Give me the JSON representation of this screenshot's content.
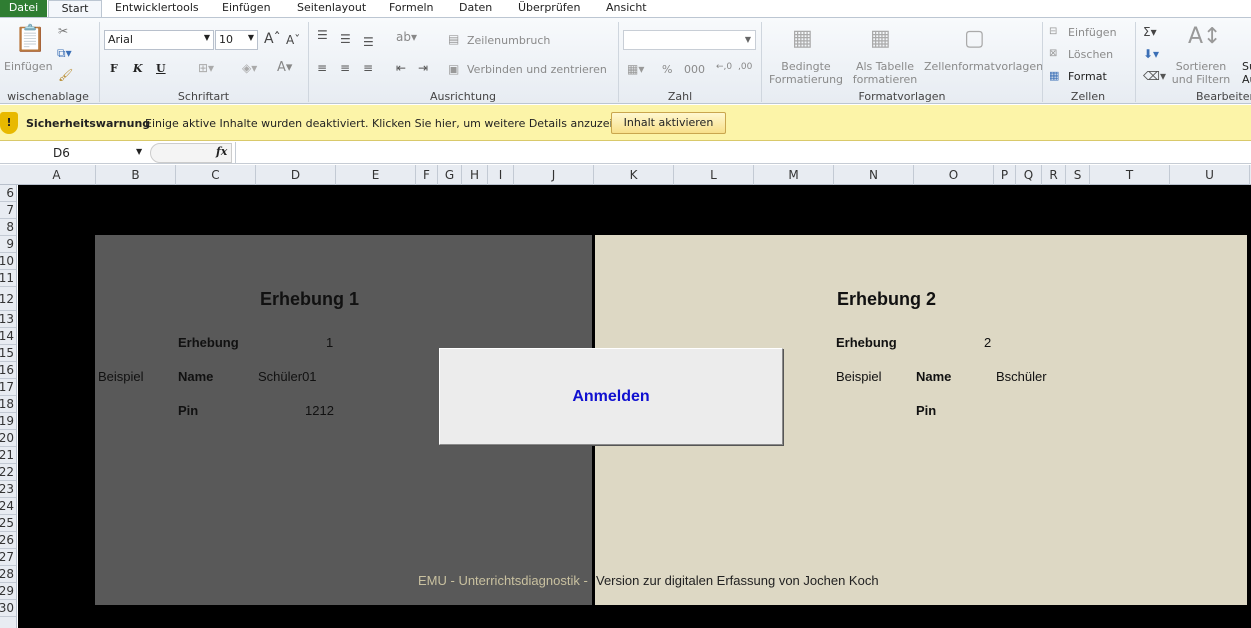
{
  "tabs": [
    "Datei",
    "Start",
    "Entwicklertools",
    "Einfügen",
    "Seitenlayout",
    "Formeln",
    "Daten",
    "Überprüfen",
    "Ansicht"
  ],
  "ribbon": {
    "clipboard": {
      "paste": "Einfügen",
      "label": "wischenablage"
    },
    "font": {
      "name": "Arial",
      "size": "10",
      "label": "Schriftart",
      "bold": "F",
      "italic": "K",
      "underline": "U"
    },
    "alignment": {
      "wrap": "Zeilenumbruch",
      "merge": "Verbinden und zentrieren",
      "label": "Ausrichtung"
    },
    "number": {
      "format": "",
      "percent": "%",
      "thousands": "000",
      "label": "Zahl"
    },
    "styles": {
      "conditional": [
        "Bedingte",
        "Formatierung"
      ],
      "table": [
        "Als Tabelle",
        "formatieren"
      ],
      "cell": "Zellenformatvorlagen",
      "label": "Formatvorlagen"
    },
    "cells": {
      "insert": "Einfügen",
      "delete": "Löschen",
      "format": "Format",
      "label": "Zellen"
    },
    "editing": {
      "sort": [
        "Sortieren",
        "und Filtern"
      ],
      "find": [
        "Su",
        "Au"
      ],
      "label": "Bearbeiten"
    }
  },
  "warning": {
    "title": "Sicherheitswarnung",
    "message": "Einige aktive Inhalte wurden deaktiviert. Klicken Sie hier, um weitere Details anzuzeigen.",
    "button": "Inhalt aktivieren"
  },
  "formula_bar": {
    "name_box": "D6",
    "fx": "fx",
    "value": ""
  },
  "columns": [
    "A",
    "B",
    "C",
    "D",
    "E",
    "F",
    "G",
    "H",
    "I",
    "J",
    "K",
    "L",
    "M",
    "N",
    "O",
    "P",
    "Q",
    "R",
    "S",
    "T",
    "U"
  ],
  "rows": [
    "6",
    "7",
    "8",
    "9",
    "10",
    "11",
    "12",
    "13",
    "14",
    "15",
    "16",
    "17",
    "18",
    "19",
    "20",
    "21",
    "22",
    "23",
    "24",
    "25",
    "26",
    "27",
    "28",
    "29",
    "30"
  ],
  "panel1": {
    "title": "Erhebung 1",
    "erhebung_label": "Erhebung",
    "erhebung_value": "1",
    "beispiel": "Beispiel",
    "name_label": "Name",
    "name_value": "Schüler01",
    "pin_label": "Pin",
    "pin_value": "1212"
  },
  "panel2": {
    "title": "Erhebung 2",
    "erhebung_label": "Erhebung",
    "erhebung_value": "2",
    "beispiel": "Beispiel",
    "name_label": "Name",
    "name_value": "Bschüler",
    "pin_label": "Pin",
    "pin_value": ""
  },
  "login_button": "Anmelden",
  "footer": {
    "left": "EMU - Unterrichtsdiagnostik - ",
    "right": "Version zur digitalen Erfassung von Jochen Koch"
  },
  "colors": {
    "panel1": "#595959",
    "panel2": "#ddd8c4",
    "login_text": "#1010d0",
    "warning_bg": "#fcf4a8"
  }
}
